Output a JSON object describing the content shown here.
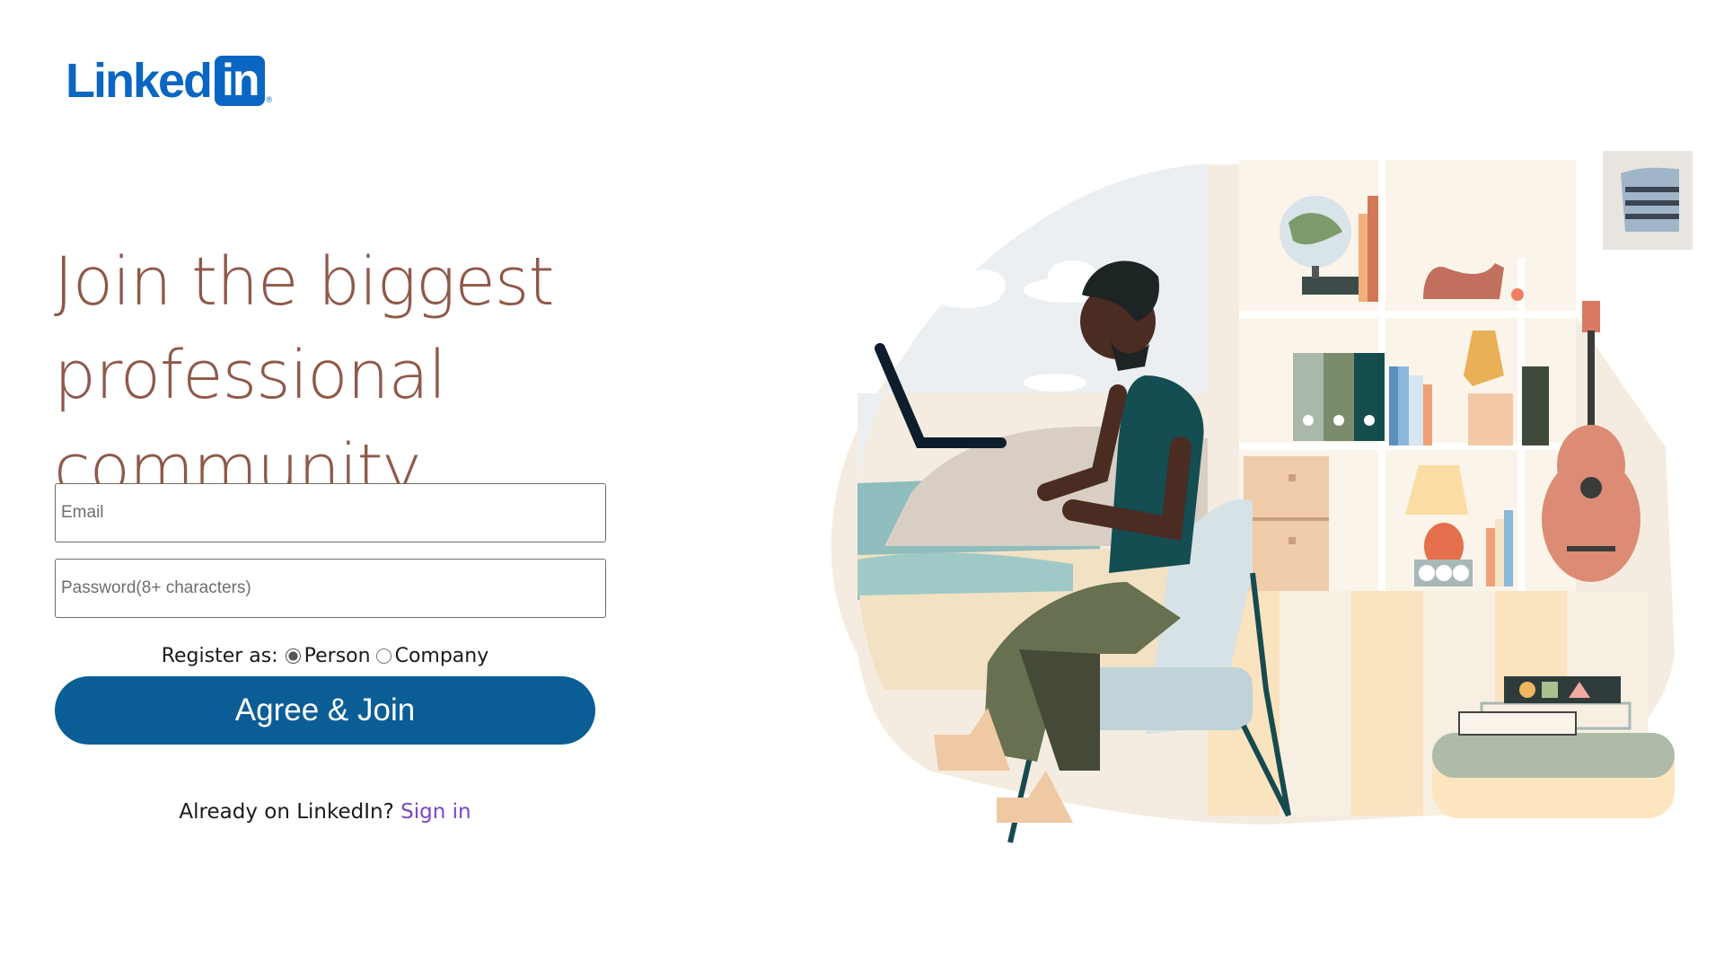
{
  "brand": {
    "word": "Linked",
    "box": "in",
    "reg": "®"
  },
  "headline": {
    "line1": "Join the biggest",
    "line2": "professional community"
  },
  "form": {
    "email_placeholder": "Email",
    "password_placeholder": "Password(8+ characters)",
    "register_label": "Register as:",
    "options": [
      {
        "label": "Person",
        "selected": true
      },
      {
        "label": "Company",
        "selected": false
      }
    ],
    "submit_label": "Agree & Join"
  },
  "signin": {
    "prompt": "Already on LinkedIn?",
    "link": "Sign in"
  },
  "colors": {
    "brand": "#0a66c2",
    "button": "#0b5d96",
    "headline": "#8f5849",
    "link": "#7b47c7"
  }
}
